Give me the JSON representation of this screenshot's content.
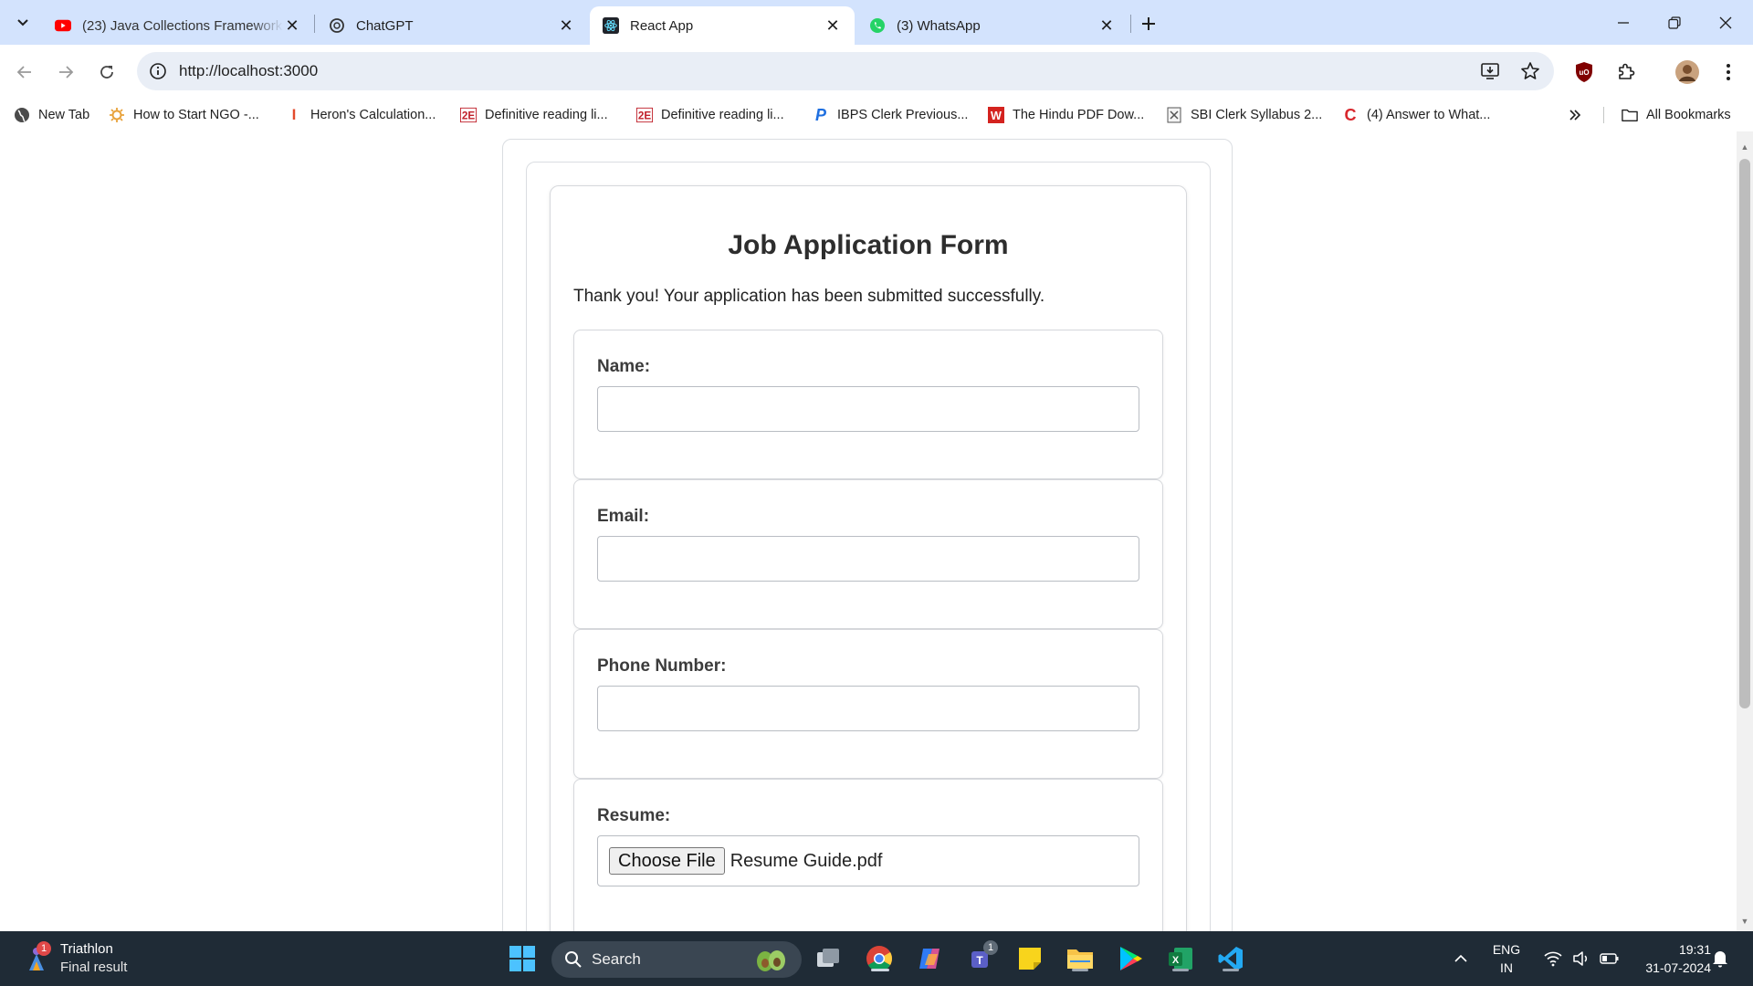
{
  "browser": {
    "tabs": [
      {
        "title": "(23) Java Collections Framework",
        "favicon": "youtube-icon",
        "active": false
      },
      {
        "title": "ChatGPT",
        "favicon": "chatgpt-icon",
        "active": false
      },
      {
        "title": "React App",
        "favicon": "react-icon",
        "active": true
      },
      {
        "title": "(3) WhatsApp",
        "favicon": "whatsapp-icon",
        "active": false
      }
    ],
    "url": "http://localhost:3000",
    "bookmarks": [
      {
        "label": "New Tab",
        "icon": "globe-icon"
      },
      {
        "label": "How to Start NGO -...",
        "icon": "ngo-icon"
      },
      {
        "label": "Heron's Calculation...",
        "icon": "heron-icon"
      },
      {
        "label": "Definitive reading li...",
        "icon": "book-icon"
      },
      {
        "label": "Definitive reading li...",
        "icon": "book-icon"
      },
      {
        "label": "IBPS Clerk Previous...",
        "icon": "p-icon"
      },
      {
        "label": "The Hindu PDF Dow...",
        "icon": "w-icon"
      },
      {
        "label": "SBI Clerk Syllabus 2...",
        "icon": "doc-icon"
      },
      {
        "label": "(4) Answer to What...",
        "icon": "c-icon"
      }
    ],
    "all_bookmarks_label": "All Bookmarks",
    "colors": {
      "tabstrip": "#d3e3fd",
      "omnibox": "#e9eef6"
    }
  },
  "form": {
    "title": "Job Application Form",
    "message": "Thank you! Your application has been submitted successfully.",
    "fields": [
      {
        "label": "Name:",
        "value": ""
      },
      {
        "label": "Email:",
        "value": ""
      },
      {
        "label": "Phone Number:",
        "value": ""
      }
    ],
    "resume": {
      "label": "Resume:",
      "button": "Choose File",
      "file_name": "Resume Guide.pdf"
    }
  },
  "taskbar": {
    "weather_title": "Triathlon",
    "weather_sub": "Final result",
    "weather_badge": "1",
    "search_label": "Search",
    "teams_badge": "1",
    "language": "ENG",
    "region": "IN",
    "time": "19:31",
    "date": "31-07-2024"
  }
}
